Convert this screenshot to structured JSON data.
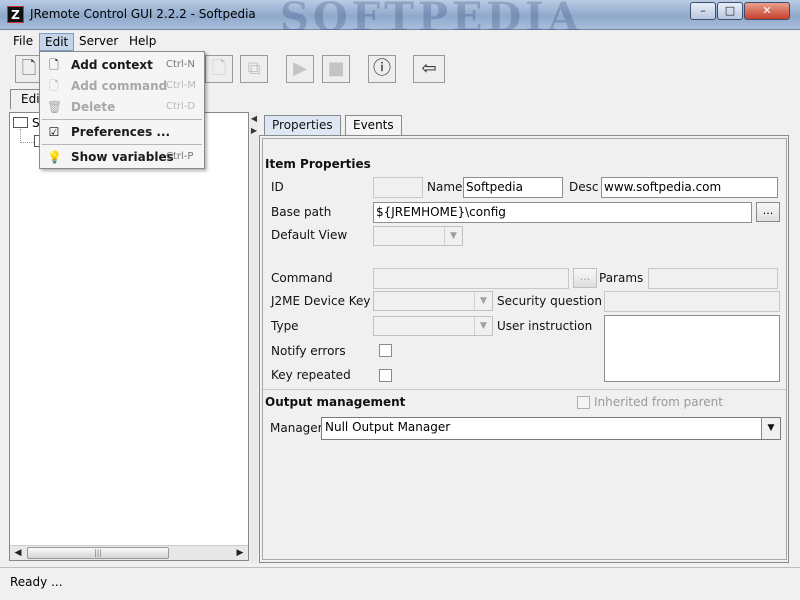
{
  "window": {
    "title": "JRemote Control GUI 2.2.2 - Softpedia",
    "logo_letter": "Z",
    "watermark": "SOFTPEDIA",
    "controls": {
      "minimize": "–",
      "maximize": "□",
      "close": "✕"
    }
  },
  "menubar": [
    "File",
    "Edit",
    "Server",
    "Help"
  ],
  "edit_menu": {
    "items": [
      {
        "label": "Add context",
        "shortcut": "Ctrl-N",
        "icon": "new-context-icon",
        "enabled": true
      },
      {
        "label": "Add command",
        "shortcut": "Ctrl-M",
        "icon": "new-command-icon",
        "enabled": false
      },
      {
        "label": "Delete",
        "shortcut": "Ctrl-D",
        "icon": "trash-icon",
        "enabled": false
      },
      {
        "label": "Preferences ...",
        "shortcut": "",
        "icon": "preferences-icon",
        "enabled": true
      },
      {
        "label": "Show variables",
        "shortcut": "Ctrl-P",
        "icon": "lightbulb-icon",
        "enabled": true
      }
    ]
  },
  "toolbar": {
    "icons": [
      "new-context-icon",
      "new-command-icon",
      "copy-icon",
      "play-icon",
      "stop-icon",
      "info-icon",
      "exit-icon"
    ]
  },
  "left_panel": {
    "tab_label": "Edi",
    "tree_root": "S"
  },
  "right_panel": {
    "tabs": [
      "Properties",
      "Events"
    ],
    "item_properties_label": "Item Properties",
    "id_label": "ID",
    "name_label": "Name",
    "name_value": "Softpedia",
    "desc_label": "Desc",
    "desc_value": "www.softpedia.com",
    "base_path_label": "Base path",
    "base_path_value": "${JREMHOME}\\config",
    "browse_label": "...",
    "default_view_label": "Default View",
    "command_label": "Command",
    "params_label": "Params",
    "j2me_label": "J2ME Device Key",
    "security_label": "Security question",
    "type_label": "Type",
    "user_instruction_label": "User instruction",
    "notify_errors_label": "Notify errors",
    "key_repeated_label": "Key repeated",
    "output_management_label": "Output management",
    "inherited_label": "Inherited from parent",
    "manager_label": "Manager",
    "manager_value": "Null Output Manager"
  },
  "status": "Ready ..."
}
